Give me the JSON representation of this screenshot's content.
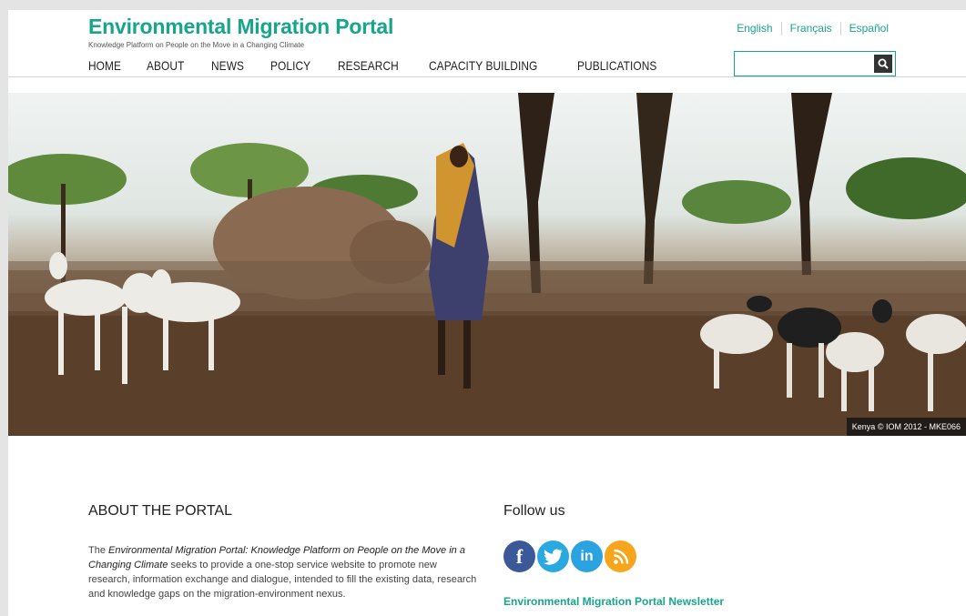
{
  "site": {
    "title": "Environmental Migration Portal",
    "tagline": "Knowledge Platform on People on the Move in a Changing Climate"
  },
  "languages": [
    "English",
    "Français",
    "Español"
  ],
  "search": {
    "placeholder": "",
    "value": ""
  },
  "nav": [
    "HOME",
    "ABOUT",
    "NEWS",
    "POLICY",
    "RESEARCH",
    "CAPACITY BUILDING",
    "PUBLICATIONS"
  ],
  "hero": {
    "caption": "Kenya © IOM 2012 - MKE066"
  },
  "about": {
    "title": "ABOUT THE PORTAL",
    "text_pre": "The ",
    "text_em": "Environmental Migration Portal: Knowledge Platform on People on the Move in a Changing Climate",
    "text_post": " seeks to provide a one-stop service website to promote new research, information exchange and dialogue, intended to fill the existing data, research and knowledge gaps on the migration-environment nexus."
  },
  "follow": {
    "title": "Follow us",
    "icons": [
      {
        "name": "facebook-icon",
        "glyph": "f",
        "color": "#3b5998"
      },
      {
        "name": "twitter-icon",
        "glyph": "t",
        "color": "#2aa9e0"
      },
      {
        "name": "linkedin-icon",
        "glyph": "in",
        "color": "#2ba3e1"
      },
      {
        "name": "rss-icon",
        "glyph": "rss",
        "color": "#f7a51c"
      }
    ],
    "newsletter": "Environmental Migration Portal Newsletter"
  },
  "colors": {
    "accent": "#17a58c",
    "background": "#e4e4e4"
  }
}
